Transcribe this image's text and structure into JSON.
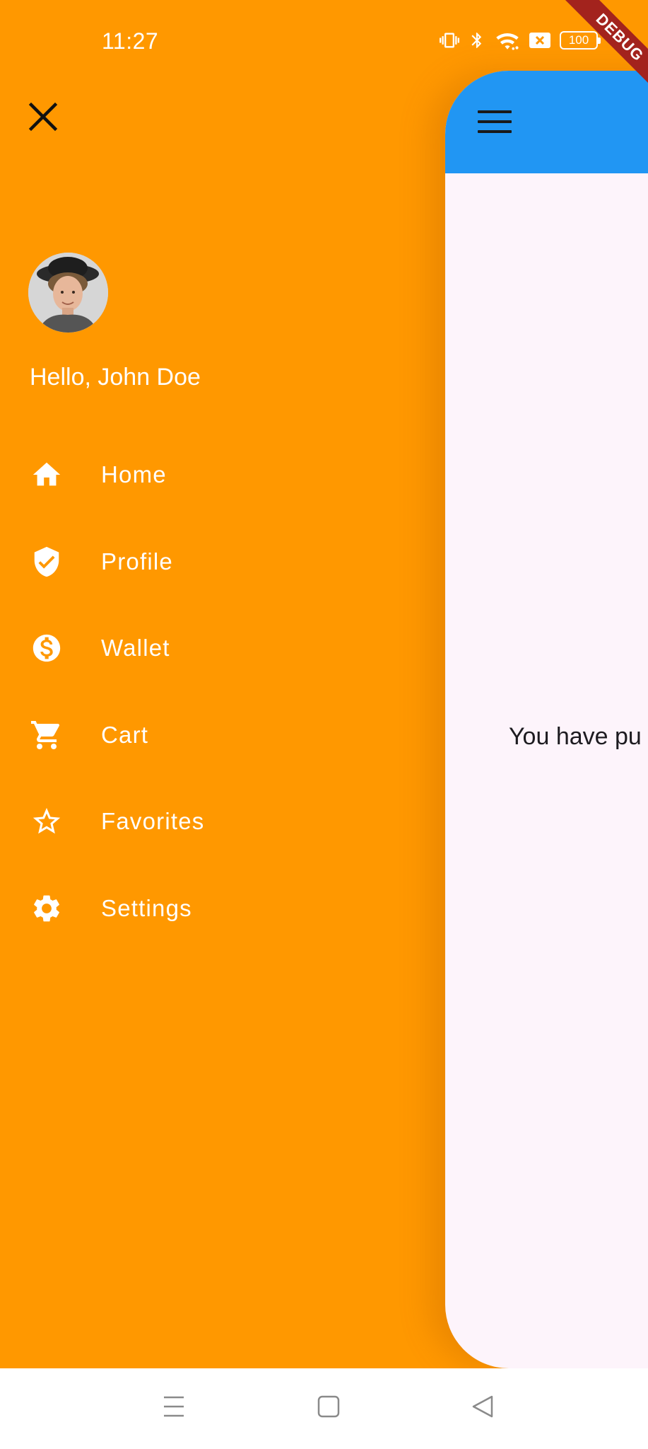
{
  "status_bar": {
    "time": "11:27",
    "battery": "100",
    "icons": [
      "vibrate-icon",
      "bluetooth-icon",
      "wifi-icon",
      "sim-off-icon",
      "battery-icon"
    ]
  },
  "drawer": {
    "background": "#FF9800",
    "close_icon": "close-icon",
    "greeting": "Hello, John Doe",
    "items": [
      {
        "label": "Home",
        "icon": "home-icon"
      },
      {
        "label": "Profile",
        "icon": "verified-shield-icon"
      },
      {
        "label": "Wallet",
        "icon": "dollar-icon"
      },
      {
        "label": "Cart",
        "icon": "cart-icon"
      },
      {
        "label": "Favorites",
        "icon": "star-icon"
      },
      {
        "label": "Settings",
        "icon": "gear-icon"
      }
    ]
  },
  "main": {
    "appbar_color": "#2196F3",
    "menu_icon": "hamburger-icon",
    "body_text": "You have pu",
    "debug_banner": "DEBUG"
  },
  "navbar": {
    "icons": [
      "recents-icon",
      "home-icon",
      "back-icon"
    ]
  }
}
